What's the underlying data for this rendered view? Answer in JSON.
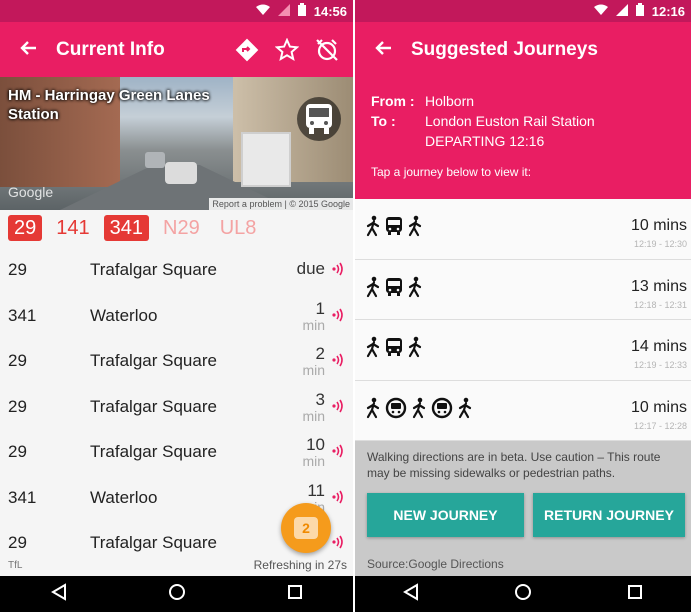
{
  "left": {
    "status": {
      "time": "14:56"
    },
    "appbar": {
      "title": "Current Info"
    },
    "stop": {
      "name": "HM - Harringay Green Lanes Station"
    },
    "map_attribution": {
      "logo": "Google",
      "report": "Report a problem",
      "copyright": "© 2015 Google"
    },
    "routes": [
      {
        "label": "29",
        "state": "selected"
      },
      {
        "label": "141",
        "state": "unselected"
      },
      {
        "label": "341",
        "state": "selected"
      },
      {
        "label": "N29",
        "state": "dim"
      },
      {
        "label": "UL8",
        "state": "dim"
      }
    ],
    "arrivals": [
      {
        "route": "29",
        "dest": "Trafalgar Square",
        "due": "due",
        "unit": ""
      },
      {
        "route": "341",
        "dest": "Waterloo",
        "due": "1",
        "unit": "min"
      },
      {
        "route": "29",
        "dest": "Trafalgar Square",
        "due": "2",
        "unit": "min"
      },
      {
        "route": "29",
        "dest": "Trafalgar Square",
        "due": "3",
        "unit": "min"
      },
      {
        "route": "29",
        "dest": "Trafalgar Square",
        "due": "10",
        "unit": "min"
      },
      {
        "route": "341",
        "dest": "Waterloo",
        "due": "11",
        "unit": "min"
      },
      {
        "route": "29",
        "dest": "Trafalgar Square",
        "due": "",
        "unit": ""
      }
    ],
    "footer": {
      "source": "TfL",
      "refresh": "Refreshing in 27s"
    },
    "fab": {
      "count": "2"
    }
  },
  "right": {
    "status": {
      "time": "12:16"
    },
    "appbar": {
      "title": "Suggested Journeys"
    },
    "from_label": "From :",
    "from": "Holborn",
    "to_label": "To :",
    "to": "London Euston Rail Station",
    "departing": "DEPARTING 12:16",
    "hint": "Tap a journey below to view it:",
    "journeys": [
      {
        "modes": [
          "walk",
          "bus",
          "walk"
        ],
        "duration": "10 mins",
        "times": "12:19 - 12:30"
      },
      {
        "modes": [
          "walk",
          "bus",
          "walk"
        ],
        "duration": "13 mins",
        "times": "12:18 - 12:31"
      },
      {
        "modes": [
          "walk",
          "bus",
          "walk"
        ],
        "duration": "14 mins",
        "times": "12:19 - 12:33"
      },
      {
        "modes": [
          "walk",
          "tube",
          "walk",
          "tube",
          "walk"
        ],
        "duration": "10 mins",
        "times": "12:17 - 12:28"
      }
    ],
    "warning": "Walking directions are in beta. Use caution – This route may be missing sidewalks or pedestrian paths.",
    "buttons": {
      "new": "NEW JOURNEY",
      "return": "RETURN JOURNEY"
    },
    "source": "Source:Google Directions"
  },
  "colors": {
    "primary": "#e91e63",
    "status_bar": "#c2185b",
    "chip": "#e53935",
    "teal": "#26a69a",
    "fab": "#f59b1c"
  },
  "icons": [
    "back-arrow-icon",
    "directions-icon",
    "star-icon",
    "alarm-off-icon",
    "bus-icon",
    "realtime-icon",
    "walk-icon",
    "tube-icon",
    "wifi-icon",
    "signal-icon",
    "battery-icon",
    "nav-back-icon",
    "nav-home-icon",
    "nav-recents-icon"
  ]
}
